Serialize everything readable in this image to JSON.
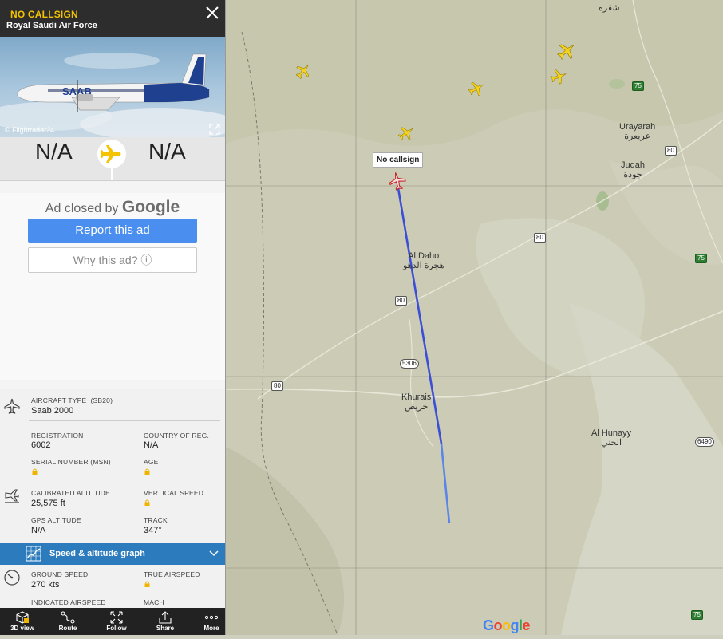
{
  "flight": {
    "callsign": "NO CALLSIGN",
    "airline": "Royal Saudi Air Force",
    "photo_credit": "© Flightradar24",
    "origin": "N/A",
    "destination": "N/A"
  },
  "ad": {
    "closed_text": "Ad closed by",
    "google_text": "Google",
    "report_label": "Report this ad",
    "why_label": "Why this ad? ⓘ"
  },
  "aircraft": {
    "type_label": "AIRCRAFT TYPE",
    "type_code": "(SB20)",
    "type_value": "Saab 2000",
    "registration_label": "REGISTRATION",
    "registration_value": "6002",
    "country_label": "COUNTRY OF REG.",
    "country_value": "N/A",
    "serial_label": "SERIAL NUMBER (MSN)",
    "age_label": "AGE"
  },
  "altitude": {
    "calibrated_label": "CALIBRATED ALTITUDE",
    "calibrated_value": "25,575 ft",
    "vertical_label": "VERTICAL SPEED",
    "gps_label": "GPS ALTITUDE",
    "gps_value": "N/A",
    "track_label": "TRACK",
    "track_value": "347°"
  },
  "graph_label": "Speed & altitude graph",
  "speed": {
    "ground_label": "GROUND SPEED",
    "ground_value": "270 kts",
    "true_label": "TRUE AIRSPEED",
    "indicated_label": "INDICATED AIRSPEED",
    "mach_label": "MACH"
  },
  "toolbar": {
    "view3d": "3D view",
    "route": "Route",
    "follow": "Follow",
    "share": "Share",
    "more": "More"
  },
  "map": {
    "callout": "No callsign",
    "places": {
      "shaqra": "شقرة",
      "urayarah": "Urayarah",
      "urayarah_ar": "عريعرة",
      "judah": "Judah",
      "judah_ar": "جودة",
      "aldaho": "Al Daho",
      "aldaho_ar": "هجرة الدهو",
      "khurais": "Khurais",
      "khurais_ar": "خريص",
      "alhunayy": "Al Hunayy",
      "alhunayy_ar": "الحني"
    },
    "roads": {
      "r80a": "80",
      "r80b": "80",
      "r80c": "80",
      "r80d": "80",
      "r5306": "5306",
      "r6490": "6490",
      "r75a": "75",
      "r75b": "75",
      "r75c": "75"
    },
    "attribution": "Google"
  },
  "colors": {
    "header_bg": "#2d2d2d",
    "callsign": "#f2c200",
    "accent_blue": "#2b7bbd",
    "plane_yellow": "#f5d31a",
    "track_blue": "#3b4ed6",
    "map_bg": "#cfcfbf"
  }
}
